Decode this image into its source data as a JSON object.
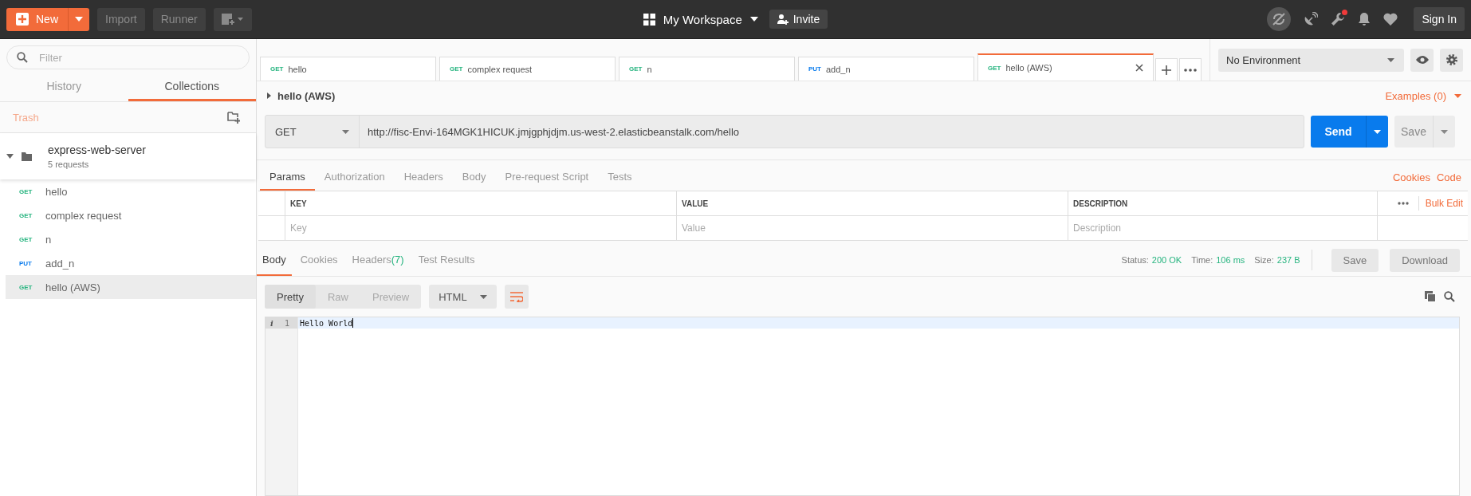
{
  "top_bar": {
    "new_button": "New",
    "import_button": "Import",
    "runner_button": "Runner",
    "workspace": "My Workspace",
    "invite_button": "Invite",
    "notification": true,
    "sign_in_button": "Sign In"
  },
  "sidebar": {
    "filter_placeholder": "Filter",
    "tabs": [
      {
        "label": "History",
        "selected": false
      },
      {
        "label": "Collections",
        "selected": true
      }
    ],
    "trash": "Trash",
    "collection": {
      "name": "express-web-server",
      "count": "5 requests",
      "expanded": true,
      "requests": [
        {
          "method": "GET",
          "color": "#26b47f",
          "name": "hello",
          "selected": false
        },
        {
          "method": "GET",
          "color": "#26b47f",
          "name": "complex request",
          "selected": false
        },
        {
          "method": "GET",
          "color": "#26b47f",
          "name": "n",
          "selected": false
        },
        {
          "method": "PUT",
          "color": "#097bed",
          "name": "add_n",
          "selected": false
        },
        {
          "method": "GET",
          "color": "#26b47f",
          "name": "hello (AWS)",
          "selected": true
        }
      ]
    }
  },
  "request_tabs": [
    {
      "method": "GET",
      "color": "#26b47f",
      "name": "hello",
      "selected": false
    },
    {
      "method": "GET",
      "color": "#26b47f",
      "name": "complex request",
      "selected": false
    },
    {
      "method": "GET",
      "color": "#26b47f",
      "name": "n",
      "selected": false
    },
    {
      "method": "PUT",
      "color": "#097bed",
      "name": "add_n",
      "selected": false
    },
    {
      "method": "GET",
      "color": "#26b47f",
      "name": "hello (AWS)",
      "selected": true
    }
  ],
  "environment": "No Environment",
  "request": {
    "name": "hello (AWS)",
    "examples": "Examples (0)",
    "method": "GET",
    "url": "http://fisc-Envi-164MGK1HICUK.jmjgphjdjm.us-west-2.elasticbeanstalk.com/hello",
    "send_button": "Send",
    "save_button": "Save"
  },
  "request_sections": {
    "tabs": [
      {
        "label": "Params",
        "selected": true
      },
      {
        "label": "Authorization",
        "selected": false
      },
      {
        "label": "Headers",
        "selected": false
      },
      {
        "label": "Body",
        "selected": false
      },
      {
        "label": "Pre-request Script",
        "selected": false
      },
      {
        "label": "Tests",
        "selected": false
      }
    ],
    "links": [
      "Cookies",
      "Code"
    ]
  },
  "params_table": {
    "columns": [
      "KEY",
      "VALUE",
      "DESCRIPTION"
    ],
    "bulk_edit": "Bulk Edit",
    "placeholders": [
      "Key",
      "Value",
      "Description"
    ]
  },
  "response": {
    "tabs": [
      {
        "label": "Body",
        "selected": true
      },
      {
        "label": "Cookies",
        "selected": false
      },
      {
        "label": "Headers",
        "count": "(7)",
        "selected": false
      },
      {
        "label": "Test Results",
        "selected": false
      }
    ],
    "status_label": "Status:",
    "status": "200 OK",
    "time_label": "Time:",
    "time": "106 ms",
    "size_label": "Size:",
    "size": "237 B",
    "save_button": "Save",
    "download_button": "Download",
    "view_modes": [
      {
        "label": "Pretty",
        "selected": true
      },
      {
        "label": "Raw",
        "selected": false
      },
      {
        "label": "Preview",
        "selected": false
      }
    ],
    "format": "HTML",
    "lines": [
      {
        "marker": "i",
        "number": "1",
        "text": "Hello World"
      }
    ]
  }
}
